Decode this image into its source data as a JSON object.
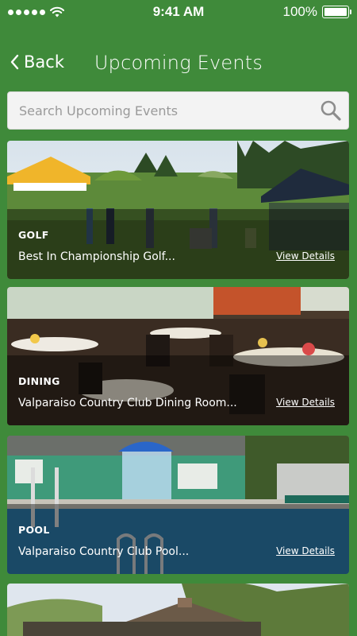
{
  "status_bar": {
    "time": "9:41 AM",
    "battery": "100%",
    "signal_icon": "signal-dots-icon",
    "wifi_icon": "wifi-icon",
    "battery_icon": "battery-icon"
  },
  "nav": {
    "back_label": "Back",
    "back_icon": "chevron-left-icon",
    "title": "Upcoming Events"
  },
  "search": {
    "placeholder": "Search Upcoming Events",
    "value": "",
    "icon": "search-icon"
  },
  "events": [
    {
      "category": "GOLF",
      "title": "Best In Championship Golf...",
      "link": "View Details"
    },
    {
      "category": "DINING",
      "title": "Valparaiso Country Club Dining Room...",
      "link": "View Details"
    },
    {
      "category": "POOL",
      "title": "Valparaiso Country Club Pool...",
      "link": "View Details"
    }
  ],
  "colors": {
    "background": "#3f8a3a",
    "search_bg": "#f3f3f3",
    "text": "#ffffff"
  }
}
